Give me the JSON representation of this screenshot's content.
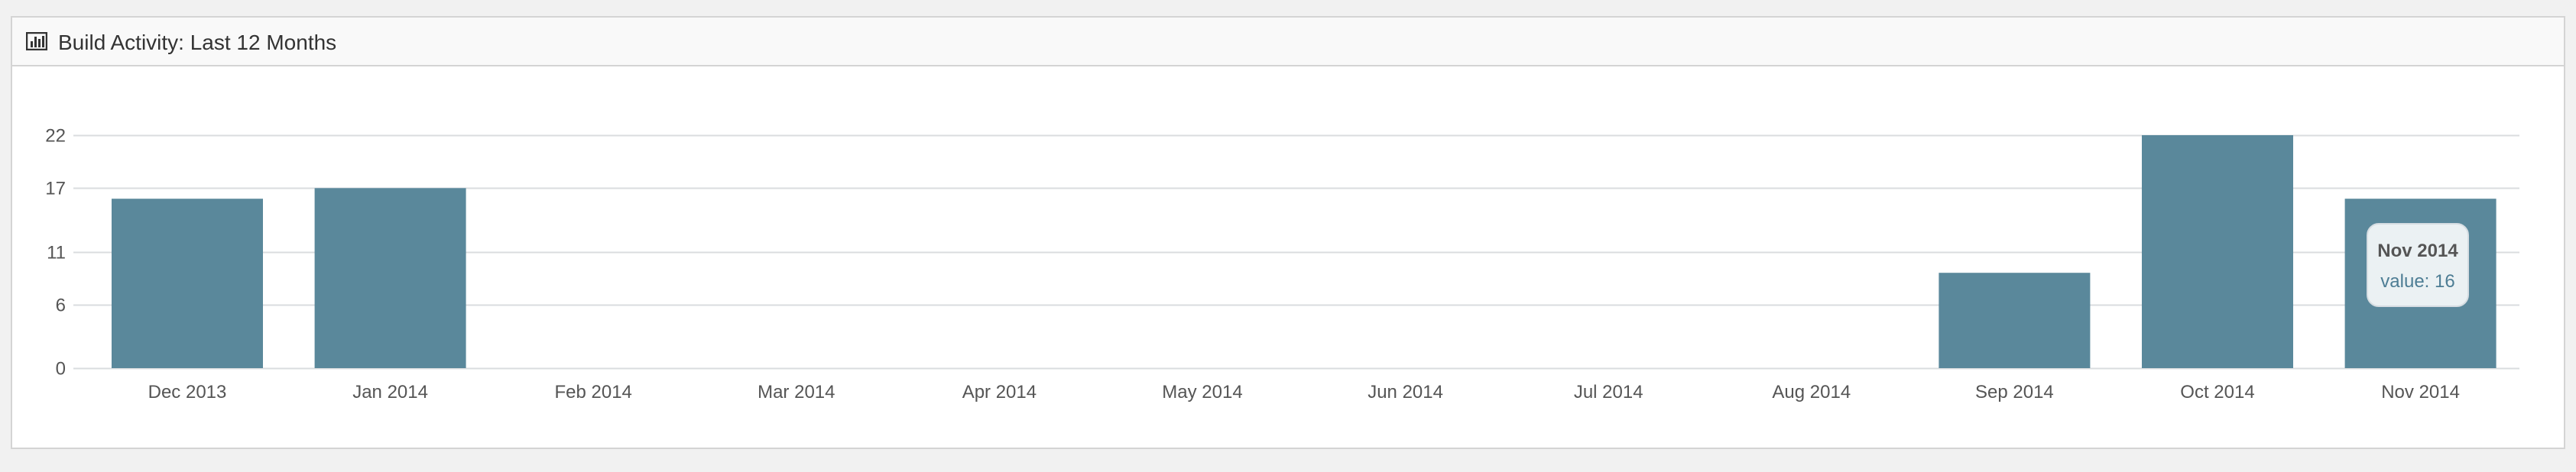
{
  "panel": {
    "title": "Build Activity: Last 12 Months",
    "icon": "bar-chart-icon"
  },
  "tooltip": {
    "title": "Nov 2014",
    "value_label": "value: 16"
  },
  "colors": {
    "bar": "#5a889b",
    "grid": "#dadcdf",
    "tick": "#555555"
  },
  "chart_data": {
    "type": "bar",
    "title": "Build Activity: Last 12 Months",
    "xlabel": "",
    "ylabel": "",
    "categories": [
      "Dec 2013",
      "Jan 2014",
      "Feb 2014",
      "Mar 2014",
      "Apr 2014",
      "May 2014",
      "Jun 2014",
      "Jul 2014",
      "Aug 2014",
      "Sep 2014",
      "Oct 2014",
      "Nov 2014"
    ],
    "values": [
      16,
      17,
      0,
      0,
      0,
      0,
      0,
      0,
      0,
      9,
      22,
      16
    ],
    "yticks": [
      0,
      6,
      11,
      17,
      22
    ],
    "ylim": [
      0,
      22
    ],
    "grid": true,
    "legend": "none"
  }
}
